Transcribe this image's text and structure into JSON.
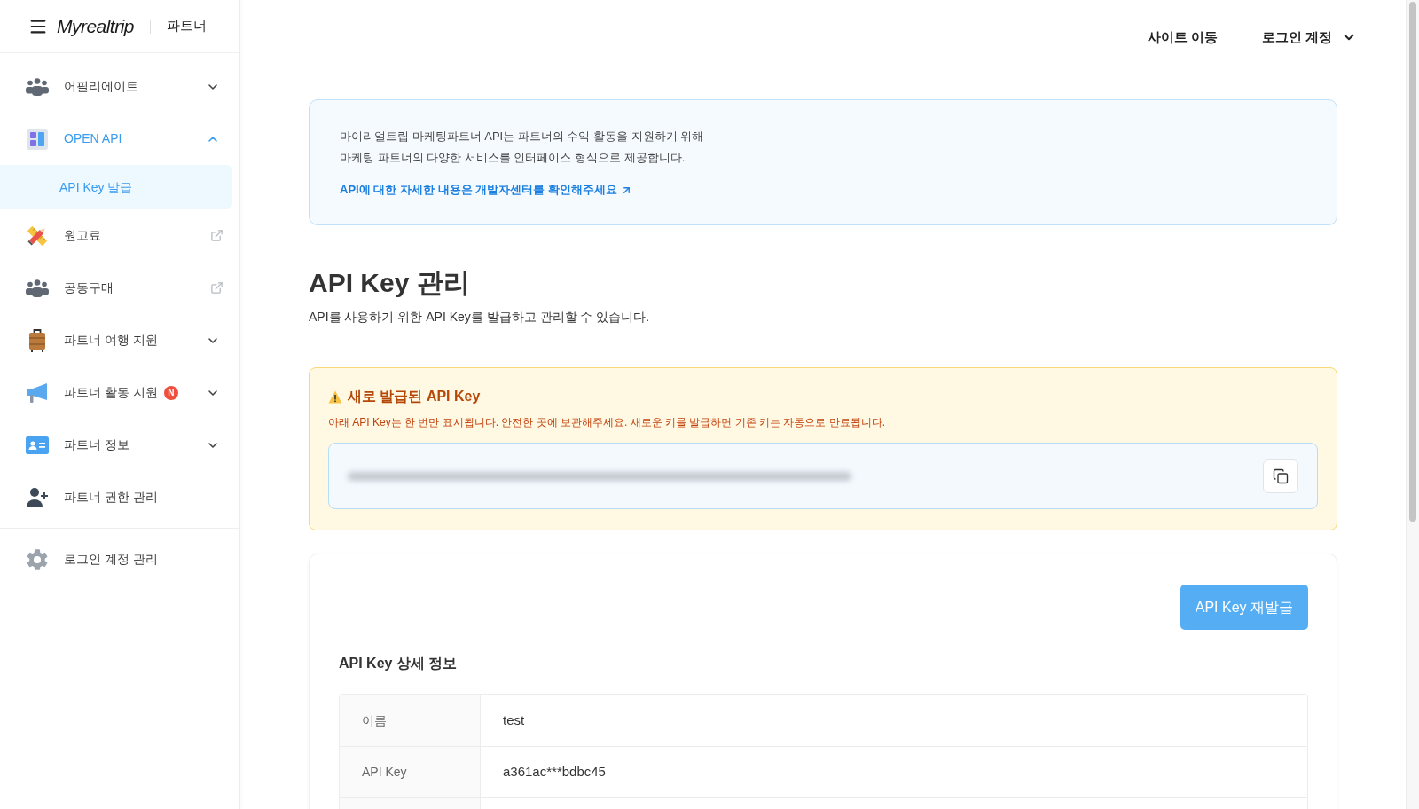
{
  "sidebar": {
    "brand": {
      "logo": "Myrealtrip",
      "label": "파트너"
    },
    "items": [
      {
        "kind": "expandable",
        "label": "어필리에이트",
        "selected": false,
        "expanded": false
      },
      {
        "kind": "expandable",
        "label": "OPEN API",
        "selected": true,
        "expanded": true,
        "children": [
          {
            "label": "API Key 발급",
            "selected": true
          }
        ]
      },
      {
        "kind": "external",
        "label": "원고료",
        "selected": false
      },
      {
        "kind": "external",
        "label": "공동구매",
        "selected": false
      },
      {
        "kind": "expandable",
        "label": "파트너 여행 지원",
        "selected": false,
        "expanded": false
      },
      {
        "kind": "expandable",
        "label": "파트너 활동 지원",
        "selected": false,
        "expanded": false,
        "badge": "N"
      },
      {
        "kind": "expandable",
        "label": "파트너 정보",
        "selected": false,
        "expanded": false
      },
      {
        "kind": "link",
        "label": "파트너 권한 관리",
        "selected": false
      }
    ],
    "bottom_items": [
      {
        "label": "로그인 계정 관리",
        "selected": false
      }
    ]
  },
  "header": {
    "site_link": "사이트 이동",
    "account_menu": "로그인 계정"
  },
  "info_box": {
    "lines": [
      "마이리얼트립 마케팅파트너 API는 파트너의 수익 활동을 지원하기 위해",
      "마케팅 파트너의 다양한 서비스를 인터페이스 형식으로 제공합니다."
    ],
    "link": "API에 대한 자세한 내용은 개발자센터를 확인해주세요"
  },
  "page": {
    "title": "API Key 관리",
    "subtitle": "API를 사용하기 위한 API Key를 발급하고 관리할 수 있습니다."
  },
  "new_key_notice": {
    "title": "새로 발급된 API Key",
    "message": "아래 API Key는 한 번만 표시됩니다. 안전한 곳에 보관해주세요. 새로운 키를 발급하면 기존 키는 자동으로 만료됩니다."
  },
  "details": {
    "reissue_button": "API Key 재발급",
    "title": "API Key 상세 정보",
    "rows": [
      {
        "label": "이름",
        "value": "test"
      },
      {
        "label": "API Key",
        "value": "a361ac***bdbc45"
      }
    ]
  }
}
